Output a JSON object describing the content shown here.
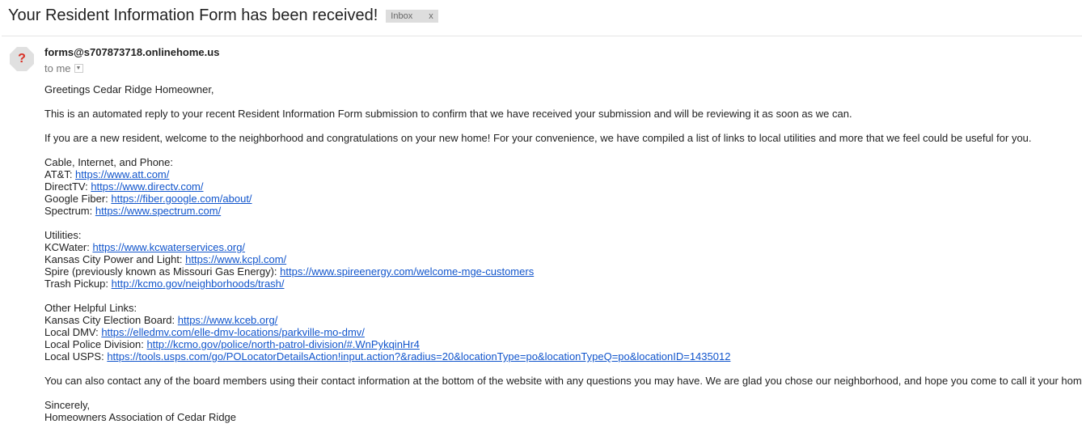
{
  "subject": "Your Resident Information Form has been received!",
  "label": {
    "name": "Inbox",
    "close": "x"
  },
  "sender": {
    "email": "forms@s707873718.onlinehome.us",
    "avatar": "?",
    "to": "to me"
  },
  "body": {
    "greeting": "Greetings Cedar Ridge Homeowner,",
    "para1": "This is an automated reply to your recent Resident Information Form submission to confirm that we have received your submission and will be reviewing it as soon as we can.",
    "para2": "If you are a new resident, welcome to the neighborhood and congratulations on your new home! For your convenience, we have compiled a list of links to local utilities and more that we feel could be useful for you.",
    "groups": [
      {
        "heading": "Cable, Internet, and Phone:",
        "items": [
          {
            "label": "AT&T: ",
            "url": "https://www.att.com/"
          },
          {
            "label": "DirectTV: ",
            "url": "https://www.directv.com/"
          },
          {
            "label": "Google Fiber: ",
            "url": "https://fiber.google.com/about/"
          },
          {
            "label": "Spectrum: ",
            "url": "https://www.spectrum.com/"
          }
        ]
      },
      {
        "heading": "Utilities:",
        "items": [
          {
            "label": "KCWater: ",
            "url": "https://www.kcwaterservices.org/"
          },
          {
            "label": "Kansas City Power and Light: ",
            "url": "https://www.kcpl.com/"
          },
          {
            "label": "Spire (previously known as Missouri Gas Energy): ",
            "url": "https://www.spireenergy.com/welcome-mge-customers"
          },
          {
            "label": "Trash Pickup: ",
            "url": "http://kcmo.gov/neighborhoods/trash/"
          }
        ]
      },
      {
        "heading": "Other Helpful Links:",
        "items": [
          {
            "label": "Kansas City Election Board: ",
            "url": "https://www.kceb.org/"
          },
          {
            "label": "Local DMV: ",
            "url": "https://elledmv.com/elle-dmv-locations/parkville-mo-dmv/"
          },
          {
            "label": "Local Police Division: ",
            "url": "http://kcmo.gov/police/north-patrol-division/#.WnPykqinHr4"
          },
          {
            "label": "Local USPS: ",
            "url": "https://tools.usps.com/go/POLocatorDetailsAction!input.action?&radius=20&locationType=po&locationTypeQ=po&locationID=1435012"
          }
        ]
      }
    ],
    "para3": "You can also contact any of the board members using their contact information at the bottom of the website with any questions you may have. We are glad you chose our neighborhood, and hope you come to call it your home!",
    "closing": "Sincerely,",
    "signature": "Homeowners Association of Cedar Ridge"
  }
}
